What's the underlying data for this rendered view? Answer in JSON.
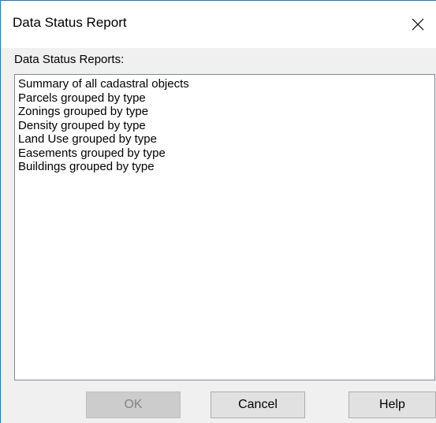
{
  "window": {
    "title": "Data Status Report",
    "close_icon": "close-icon"
  },
  "list": {
    "label": "Data Status Reports:",
    "items": [
      "Summary of all cadastral objects",
      "Parcels grouped by type",
      "Zonings grouped by type",
      "Density grouped by type",
      "Land Use grouped by type",
      "Easements grouped by type",
      "Buildings grouped by type"
    ]
  },
  "buttons": {
    "ok": "OK",
    "cancel": "Cancel",
    "help": "Help"
  },
  "colors": {
    "window_border": "#1979ca",
    "dialog_bg": "#f0f0f0",
    "button_bg": "#e1e1e1",
    "disabled_text": "#838383"
  },
  "state": {
    "ok_enabled": false
  }
}
